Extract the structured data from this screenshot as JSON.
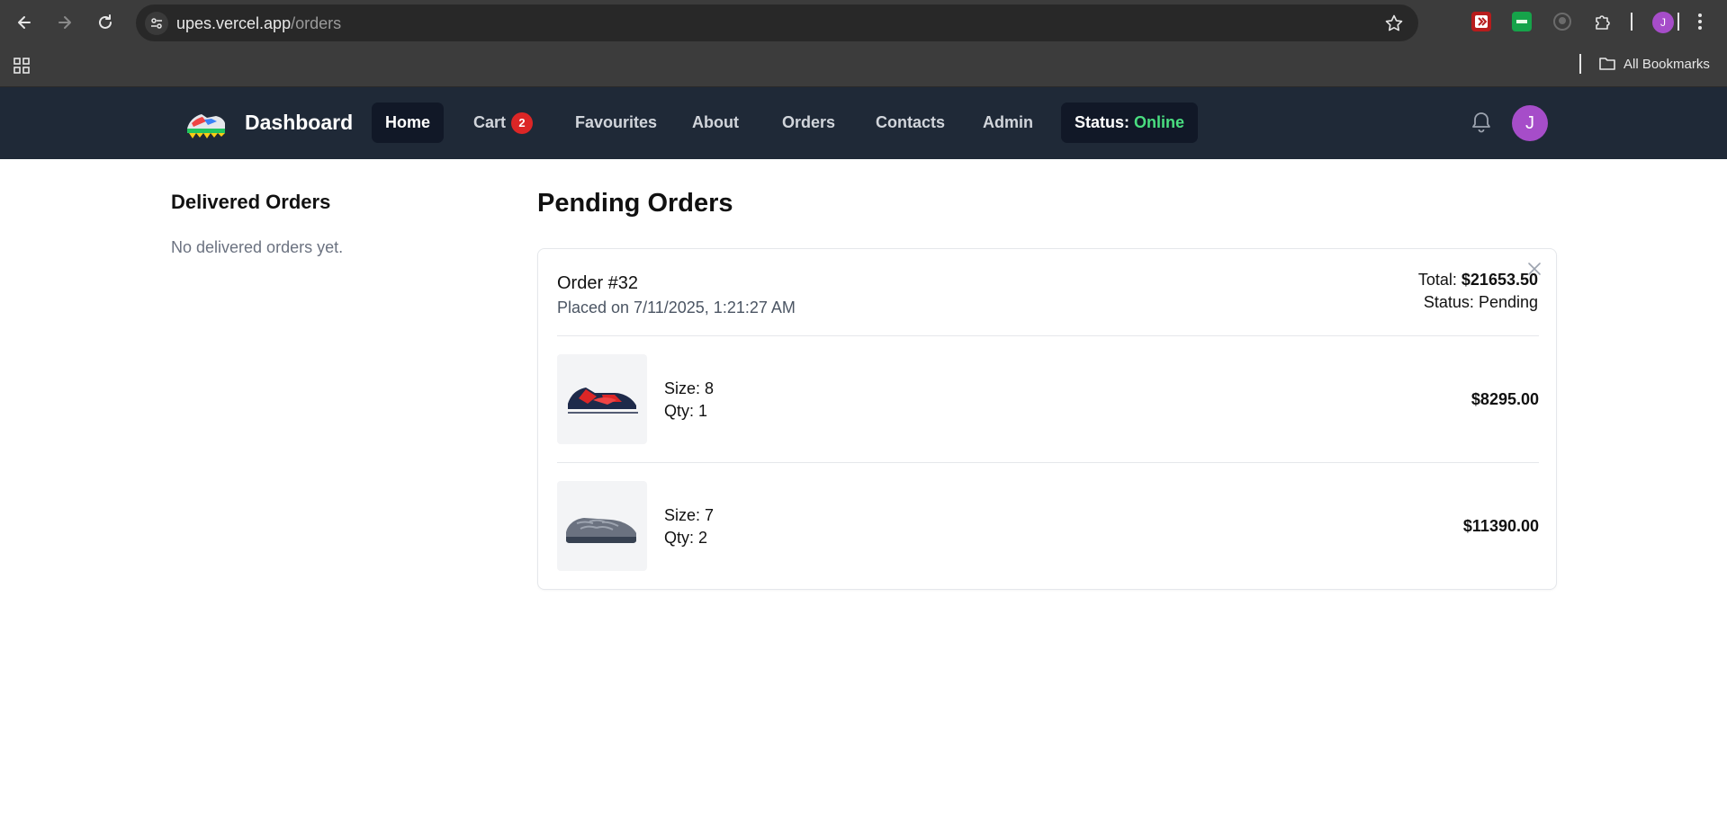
{
  "browser": {
    "url_host": "upes.vercel.app",
    "url_path": "/orders",
    "profile_initial": "J",
    "bookmarks_label": "All Bookmarks",
    "extensions": [
      "red-extension-icon",
      "green-extension-icon",
      "github-icon",
      "puzzle-icon"
    ]
  },
  "nav": {
    "brand": "Dashboard",
    "items": [
      {
        "label": "Home",
        "active": true
      },
      {
        "label": "Cart"
      },
      {
        "label": "Favourites"
      },
      {
        "label": "About"
      },
      {
        "label": "Orders"
      },
      {
        "label": "Contacts"
      },
      {
        "label": "Admin"
      }
    ],
    "cart_count": "2",
    "status_label": "Status:",
    "status_value": "Online",
    "status_color": "#4ade80",
    "avatar_initial": "J"
  },
  "delivered": {
    "title": "Delivered Orders",
    "empty_text": "No delivered orders yet."
  },
  "pending": {
    "title": "Pending Orders",
    "order": {
      "id_label": "Order #32",
      "placed_text": "Placed on 7/11/2025, 1:21:27 AM",
      "total_label": "Total:",
      "total_value": "$21653.50",
      "status_text": "Status: Pending",
      "items": [
        {
          "size": "Size: 8",
          "qty": "Qty: 1",
          "price": "$8295.00",
          "shoe": "red-navy-sneaker"
        },
        {
          "size": "Size: 7",
          "qty": "Qty: 2",
          "price": "$11390.00",
          "shoe": "grey-clog"
        }
      ]
    }
  }
}
